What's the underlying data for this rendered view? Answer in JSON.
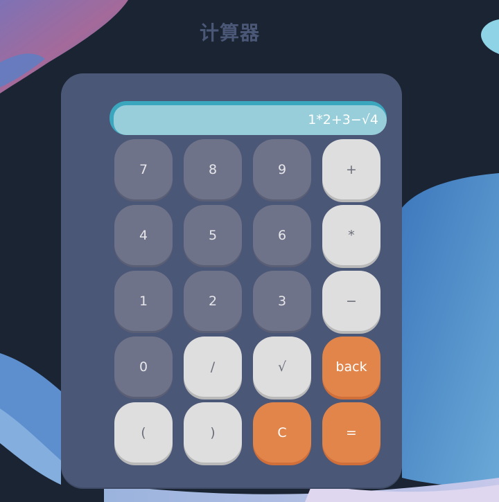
{
  "app": {
    "title": "计算器"
  },
  "display": {
    "expression": "1*2+3−√4"
  },
  "colors": {
    "background": "#1b2433",
    "panel": "#4b5776",
    "display_outer": "#3aa7bf",
    "display_inner": "#97ced9",
    "number_key": "#6f7389",
    "operator_key": "#dedede",
    "accent_key": "#e2854b"
  },
  "keys": [
    {
      "label": "7",
      "kind": "num",
      "name": "key-7"
    },
    {
      "label": "8",
      "kind": "num",
      "name": "key-8"
    },
    {
      "label": "9",
      "kind": "num",
      "name": "key-9"
    },
    {
      "label": "+",
      "kind": "op",
      "name": "key-plus"
    },
    {
      "label": "4",
      "kind": "num",
      "name": "key-4"
    },
    {
      "label": "5",
      "kind": "num",
      "name": "key-5"
    },
    {
      "label": "6",
      "kind": "num",
      "name": "key-6"
    },
    {
      "label": "*",
      "kind": "op",
      "name": "key-multiply"
    },
    {
      "label": "1",
      "kind": "num",
      "name": "key-1"
    },
    {
      "label": "2",
      "kind": "num",
      "name": "key-2"
    },
    {
      "label": "3",
      "kind": "num",
      "name": "key-3"
    },
    {
      "label": "−",
      "kind": "op",
      "name": "key-minus"
    },
    {
      "label": "0",
      "kind": "num",
      "name": "key-0"
    },
    {
      "label": "/",
      "kind": "op",
      "name": "key-divide"
    },
    {
      "label": "√",
      "kind": "op",
      "name": "key-sqrt"
    },
    {
      "label": "back",
      "kind": "accent",
      "name": "key-back"
    },
    {
      "label": "(",
      "kind": "op",
      "name": "key-open-paren"
    },
    {
      "label": ")",
      "kind": "op",
      "name": "key-close-paren"
    },
    {
      "label": "C",
      "kind": "accent",
      "name": "key-clear"
    },
    {
      "label": "=",
      "kind": "accent",
      "name": "key-equals"
    }
  ]
}
